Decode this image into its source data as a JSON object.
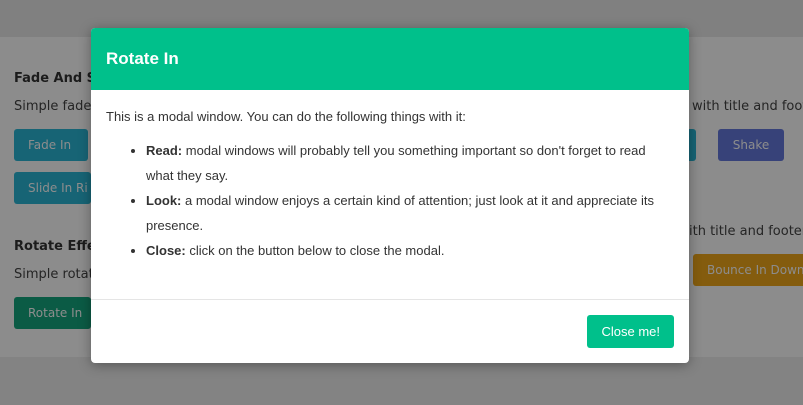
{
  "background": {
    "fade_section": {
      "title": "Fade And Sli",
      "desc": "Simple fade n",
      "desc_right": "with title and footer",
      "buttons": [
        "Fade In",
        "Shake",
        "Slide In Ri"
      ]
    },
    "rotate_section": {
      "title": "Rotate Effec",
      "desc": "Simple rotate",
      "desc_right": "ith title and footer",
      "buttons": [
        "Rotate In",
        "Bounce In Down"
      ]
    }
  },
  "modal": {
    "title": "Rotate In",
    "intro": "This is a modal window. You can do the following things with it:",
    "items": [
      {
        "term": "Read:",
        "text": " modal windows will probably tell you something important so don't forget to read what they say."
      },
      {
        "term": "Look:",
        "text": " a modal window enjoys a certain kind of attention; just look at it and appreciate its presence."
      },
      {
        "term": "Close:",
        "text": " click on the button below to close the modal."
      }
    ],
    "close_label": "Close me!"
  },
  "colors": {
    "accent": "#00c08b",
    "overlay": "rgba(0,0,0,0.45)"
  }
}
